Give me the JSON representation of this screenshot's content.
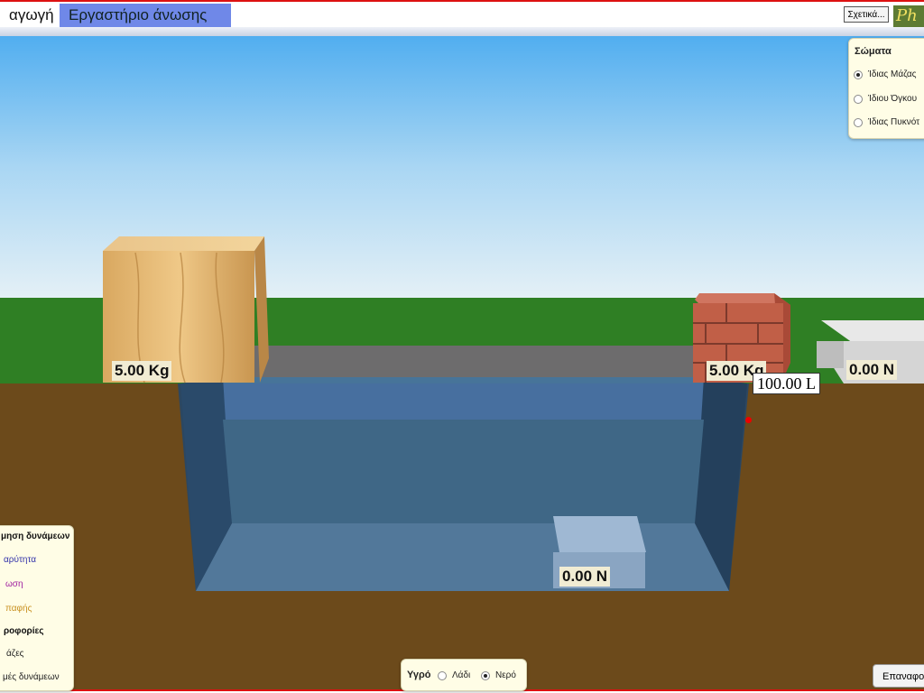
{
  "tabs": {
    "intro": "αγωγή",
    "lab": "Εργαστήριο άνωσης"
  },
  "header": {
    "about_button": "Σχετικά...",
    "logo": "Ph"
  },
  "bodies_panel": {
    "title": "Σώματα",
    "options": [
      "Ίδιας Μάζας",
      "Ίδιου Όγκου",
      "Ίδιας Πυκνότ"
    ],
    "selected_index": 0
  },
  "scene": {
    "wood_mass": "5.00 Kg",
    "brick_mass": "5.00 Kg",
    "scale_right_reading": "0.00 N",
    "scale_pool_reading": "0.00 N",
    "volume": "100.00 L"
  },
  "forces_panel": {
    "items": [
      "μηση δυνάμεων",
      "αρύτητα",
      "ωση",
      "παφής",
      "ροφορίες",
      "άζες",
      "μές δυνάμεων"
    ],
    "colors": [
      "#111111",
      "#3333aa",
      "#a020a0",
      "#c89020",
      "#111111",
      "#333333",
      "#333333"
    ]
  },
  "fluid_panel": {
    "label": "Υγρό",
    "options": [
      "Λάδι",
      "Νερό"
    ],
    "selected_index": 1
  },
  "reset_button": "Επαναφορά",
  "colors": {
    "sky": "#51aef0",
    "grass": "#2f7f24",
    "ground": "#6c4a1b",
    "water": "#3f6f9c",
    "tab_active": "#6f88e8"
  }
}
